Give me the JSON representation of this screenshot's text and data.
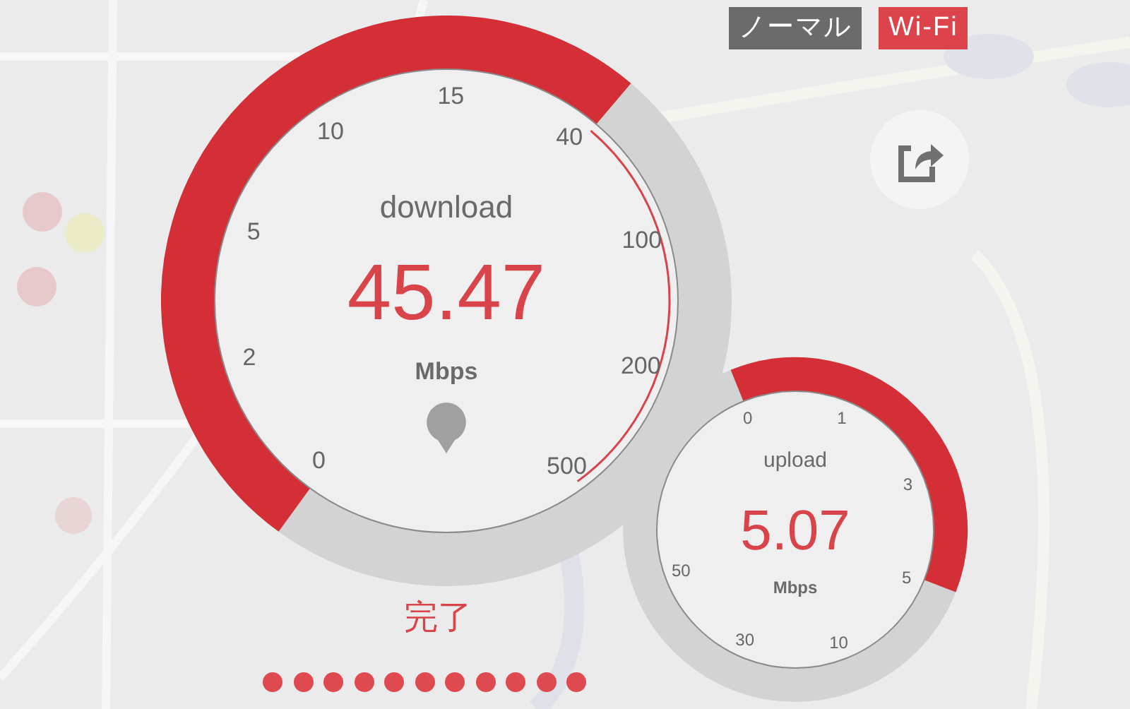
{
  "mode_badges": [
    {
      "label": "ノーマル",
      "kind": "mode"
    },
    {
      "label": "Wi-Fi",
      "kind": "network"
    }
  ],
  "download": {
    "title": "download",
    "value": "45.47",
    "unit": "Mbps",
    "scale": [
      "0",
      "2",
      "5",
      "10",
      "15",
      "40",
      "100",
      "200",
      "500"
    ]
  },
  "upload": {
    "title": "upload",
    "value": "5.07",
    "unit": "Mbps",
    "scale": [
      "0",
      "1",
      "3",
      "5",
      "10",
      "30",
      "50"
    ]
  },
  "status": "完了",
  "progress": [
    {
      "done": true
    },
    {
      "done": true
    },
    {
      "done": true
    },
    {
      "done": true
    },
    {
      "done": true
    },
    {
      "done": true
    },
    {
      "done": true
    },
    {
      "done": true
    },
    {
      "done": true
    },
    {
      "done": true
    },
    {
      "done": true
    }
  ]
}
